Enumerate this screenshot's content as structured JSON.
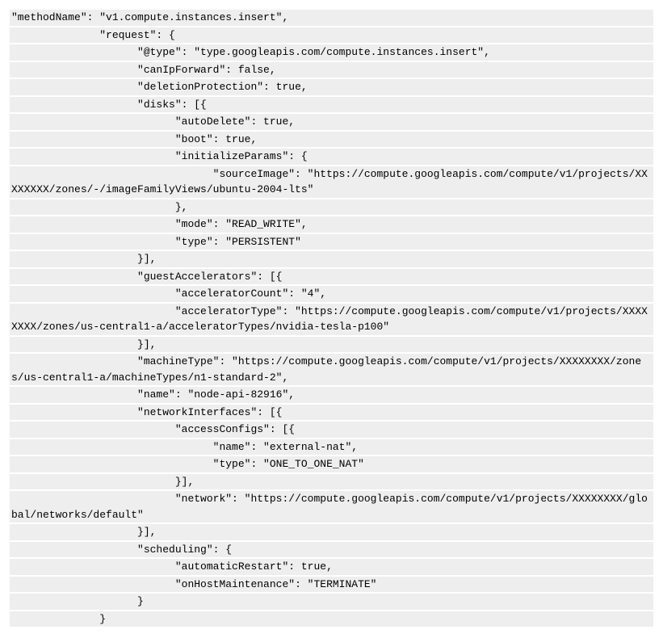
{
  "lines": {
    "l0": "\"methodName\": \"v1.compute.instances.insert\",",
    "l1": "              \"request\": {",
    "l2": "                    \"@type\": \"type.googleapis.com/compute.instances.insert\",",
    "l3": "                    \"canIpForward\": false,",
    "l4": "                    \"deletionProtection\": true,",
    "l5": "                    \"disks\": [{",
    "l6": "                          \"autoDelete\": true,",
    "l7": "                          \"boot\": true,",
    "l8": "                          \"initializeParams\": {",
    "l9": "                                \"sourceImage\": \"https://compute.googleapis.com/compute/v1/projects/XXXXXXXX/zones/-/imageFamilyViews/ubuntu-2004-lts\"",
    "l10": "                          },",
    "l11": "                          \"mode\": \"READ_WRITE\",",
    "l12": "                          \"type\": \"PERSISTENT\"",
    "l13": "                    }],",
    "l14": "                    \"guestAccelerators\": [{",
    "l15": "                          \"acceleratorCount\": \"4\",",
    "l16": "                          \"acceleratorType\": \"https://compute.googleapis.com/compute/v1/projects/XXXXXXXX/zones/us-central1-a/acceleratorTypes/nvidia-tesla-p100\"",
    "l17": "                    }],",
    "l18": "                    \"machineType\": \"https://compute.googleapis.com/compute/v1/projects/XXXXXXXX/zones/us-central1-a/machineTypes/n1-standard-2\",",
    "l19": "                    \"name\": \"node-api-82916\",",
    "l20": "                    \"networkInterfaces\": [{",
    "l21": "                          \"accessConfigs\": [{",
    "l22": "                                \"name\": \"external-nat\",",
    "l23": "                                \"type\": \"ONE_TO_ONE_NAT\"",
    "l24": "                          }],",
    "l25": "                          \"network\": \"https://compute.googleapis.com/compute/v1/projects/XXXXXXXX/global/networks/default\"",
    "l26": "                    }],",
    "l27": "                    \"scheduling\": {",
    "l28": "                          \"automaticRestart\": true,",
    "l29": "                          \"onHostMaintenance\": \"TERMINATE\"",
    "l30": "                    }",
    "l31": "              }"
  }
}
